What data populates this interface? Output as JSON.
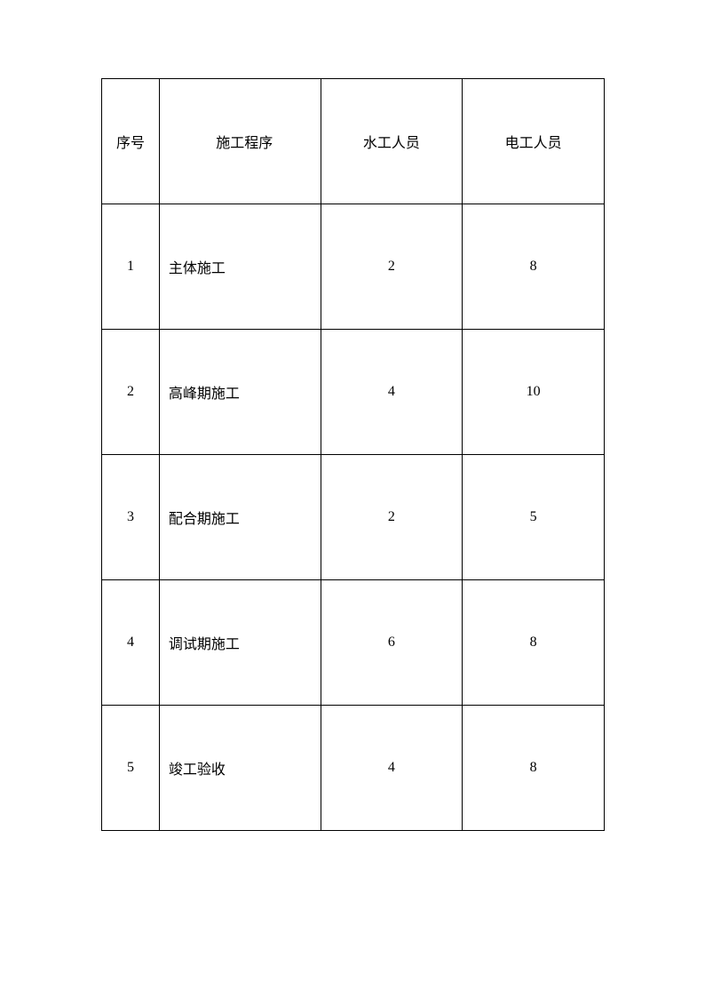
{
  "table": {
    "headers": {
      "seq": "序号",
      "procedure": "施工程序",
      "water": "水工人员",
      "electric": "电工人员"
    },
    "rows": [
      {
        "seq": "1",
        "procedure": "主体施工",
        "water": "2",
        "electric": "8"
      },
      {
        "seq": "2",
        "procedure": "高峰期施工",
        "water": "4",
        "electric": "10"
      },
      {
        "seq": "3",
        "procedure": "配合期施工",
        "water": "2",
        "electric": "5"
      },
      {
        "seq": "4",
        "procedure": "调试期施工",
        "water": "6",
        "electric": "8"
      },
      {
        "seq": "5",
        "procedure": "竣工验收",
        "water": "4",
        "electric": "8"
      }
    ]
  }
}
